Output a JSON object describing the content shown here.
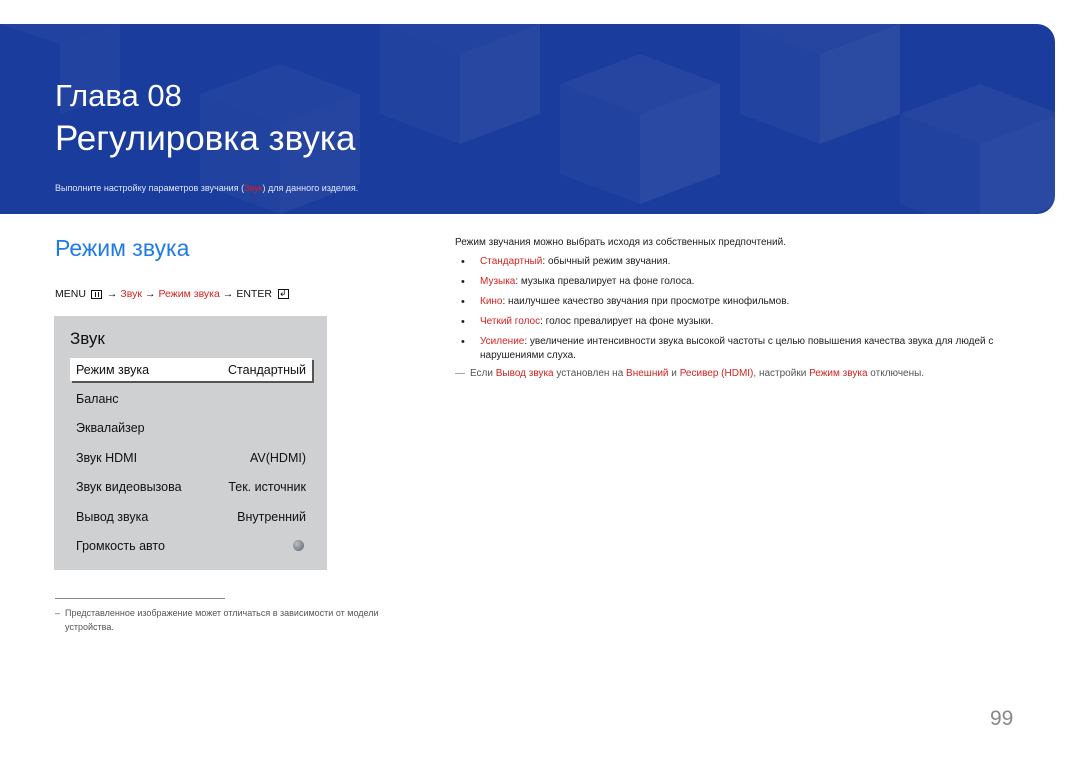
{
  "header": {
    "chapter_label": "Глава 08",
    "chapter_title": "Регулировка звука",
    "intro_before": "Выполните настройку параметров звучания (",
    "intro_link": "Звук",
    "intro_after": ") для данного изделия."
  },
  "section": {
    "heading": "Режим звука"
  },
  "menu_path": {
    "menu": "MENU",
    "arrow": "→",
    "step1": "Звук",
    "step2": "Режим звука",
    "enter": "ENTER"
  },
  "osd": {
    "title": "Звук",
    "rows": [
      {
        "label": "Режим звука",
        "value": "Стандартный",
        "selected": true
      },
      {
        "label": "Баланс",
        "value": ""
      },
      {
        "label": "Эквалайзер",
        "value": ""
      },
      {
        "label": "Звук HDMI",
        "value": "AV(HDMI)"
      },
      {
        "label": "Звук видеовызова",
        "value": "Тек. источник"
      },
      {
        "label": "Вывод звука",
        "value": "Внутренний"
      },
      {
        "label": "Громкость авто",
        "value": ""
      }
    ]
  },
  "footnote": {
    "dash": "–",
    "text": "Представленное изображение может отличаться в зависимости от модели устройства."
  },
  "description": {
    "intro": "Режим звучания можно выбрать исходя из собственных предпочтений.",
    "items": [
      {
        "term": "Стандартный",
        "text": ": обычный режим звучания."
      },
      {
        "term": "Музыка",
        "text": ": музыка превалирует на фоне голоса."
      },
      {
        "term": "Кино",
        "text": ": наилучшее качество звучания при просмотре кинофильмов."
      },
      {
        "term": "Четкий голос",
        "text": ": голос превалирует на фоне музыки."
      },
      {
        "term": "Усиление",
        "text": ": увеличение интенсивности звука высокой частоты с целью повышения качества звука для людей с нарушениями слуха."
      }
    ],
    "note": {
      "dash": "―",
      "p1": "Если ",
      "t1": "Вывод звука",
      "p2": " установлен на ",
      "t2": "Внешний",
      "p3": " и ",
      "t3": "Ресивер (HDMI)",
      "p4": ", настройки ",
      "t4": "Режим звука",
      "p5": " отключены."
    }
  },
  "page_number": "99",
  "colors": {
    "banner": "#1a3c9c",
    "accent_blue": "#1f7be6",
    "link_red": "#d2231f",
    "osd_background": "#cfd0d1"
  }
}
